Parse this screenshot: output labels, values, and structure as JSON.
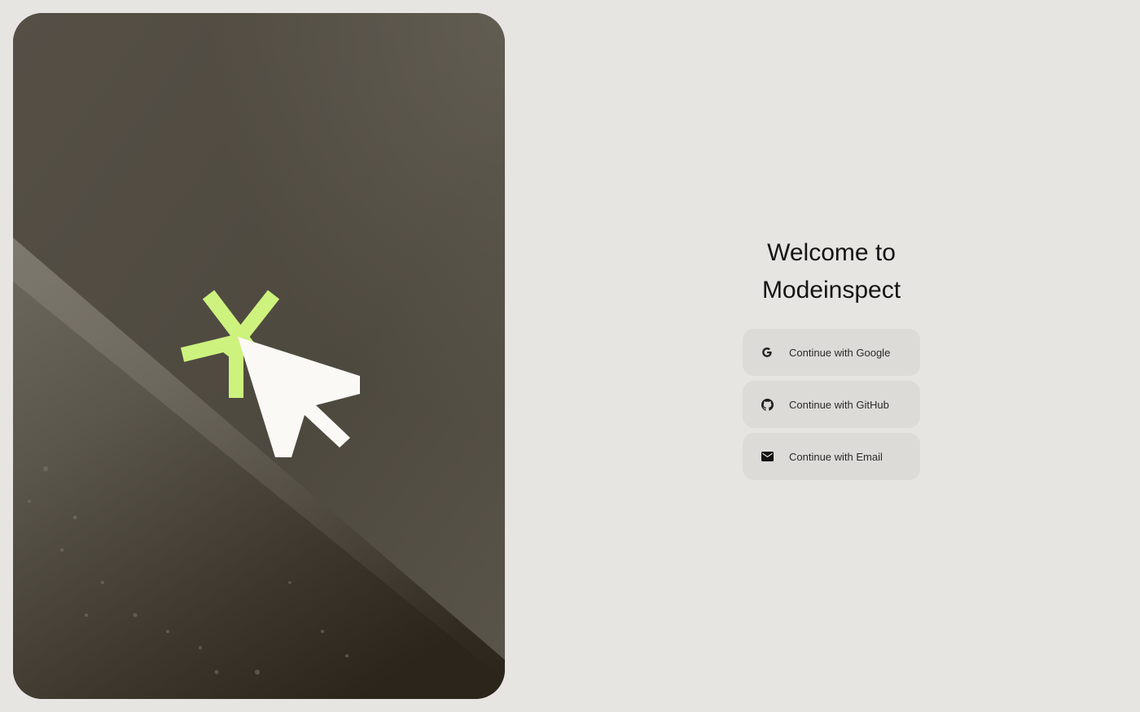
{
  "auth": {
    "title": "Welcome to Modeinspect",
    "buttons": [
      {
        "label": "Continue with Google",
        "icon": "google-icon"
      },
      {
        "label": "Continue with GitHub",
        "icon": "github-icon"
      },
      {
        "label": "Continue with Email",
        "icon": "email-icon"
      }
    ]
  },
  "hero": {
    "icon": "cursor-click-icon",
    "accent_color": "#cdf27e",
    "cursor_color": "#faf9f6"
  },
  "colors": {
    "page_background": "#e7e5e2",
    "button_background": "#dddbd8",
    "text": "#141414"
  }
}
